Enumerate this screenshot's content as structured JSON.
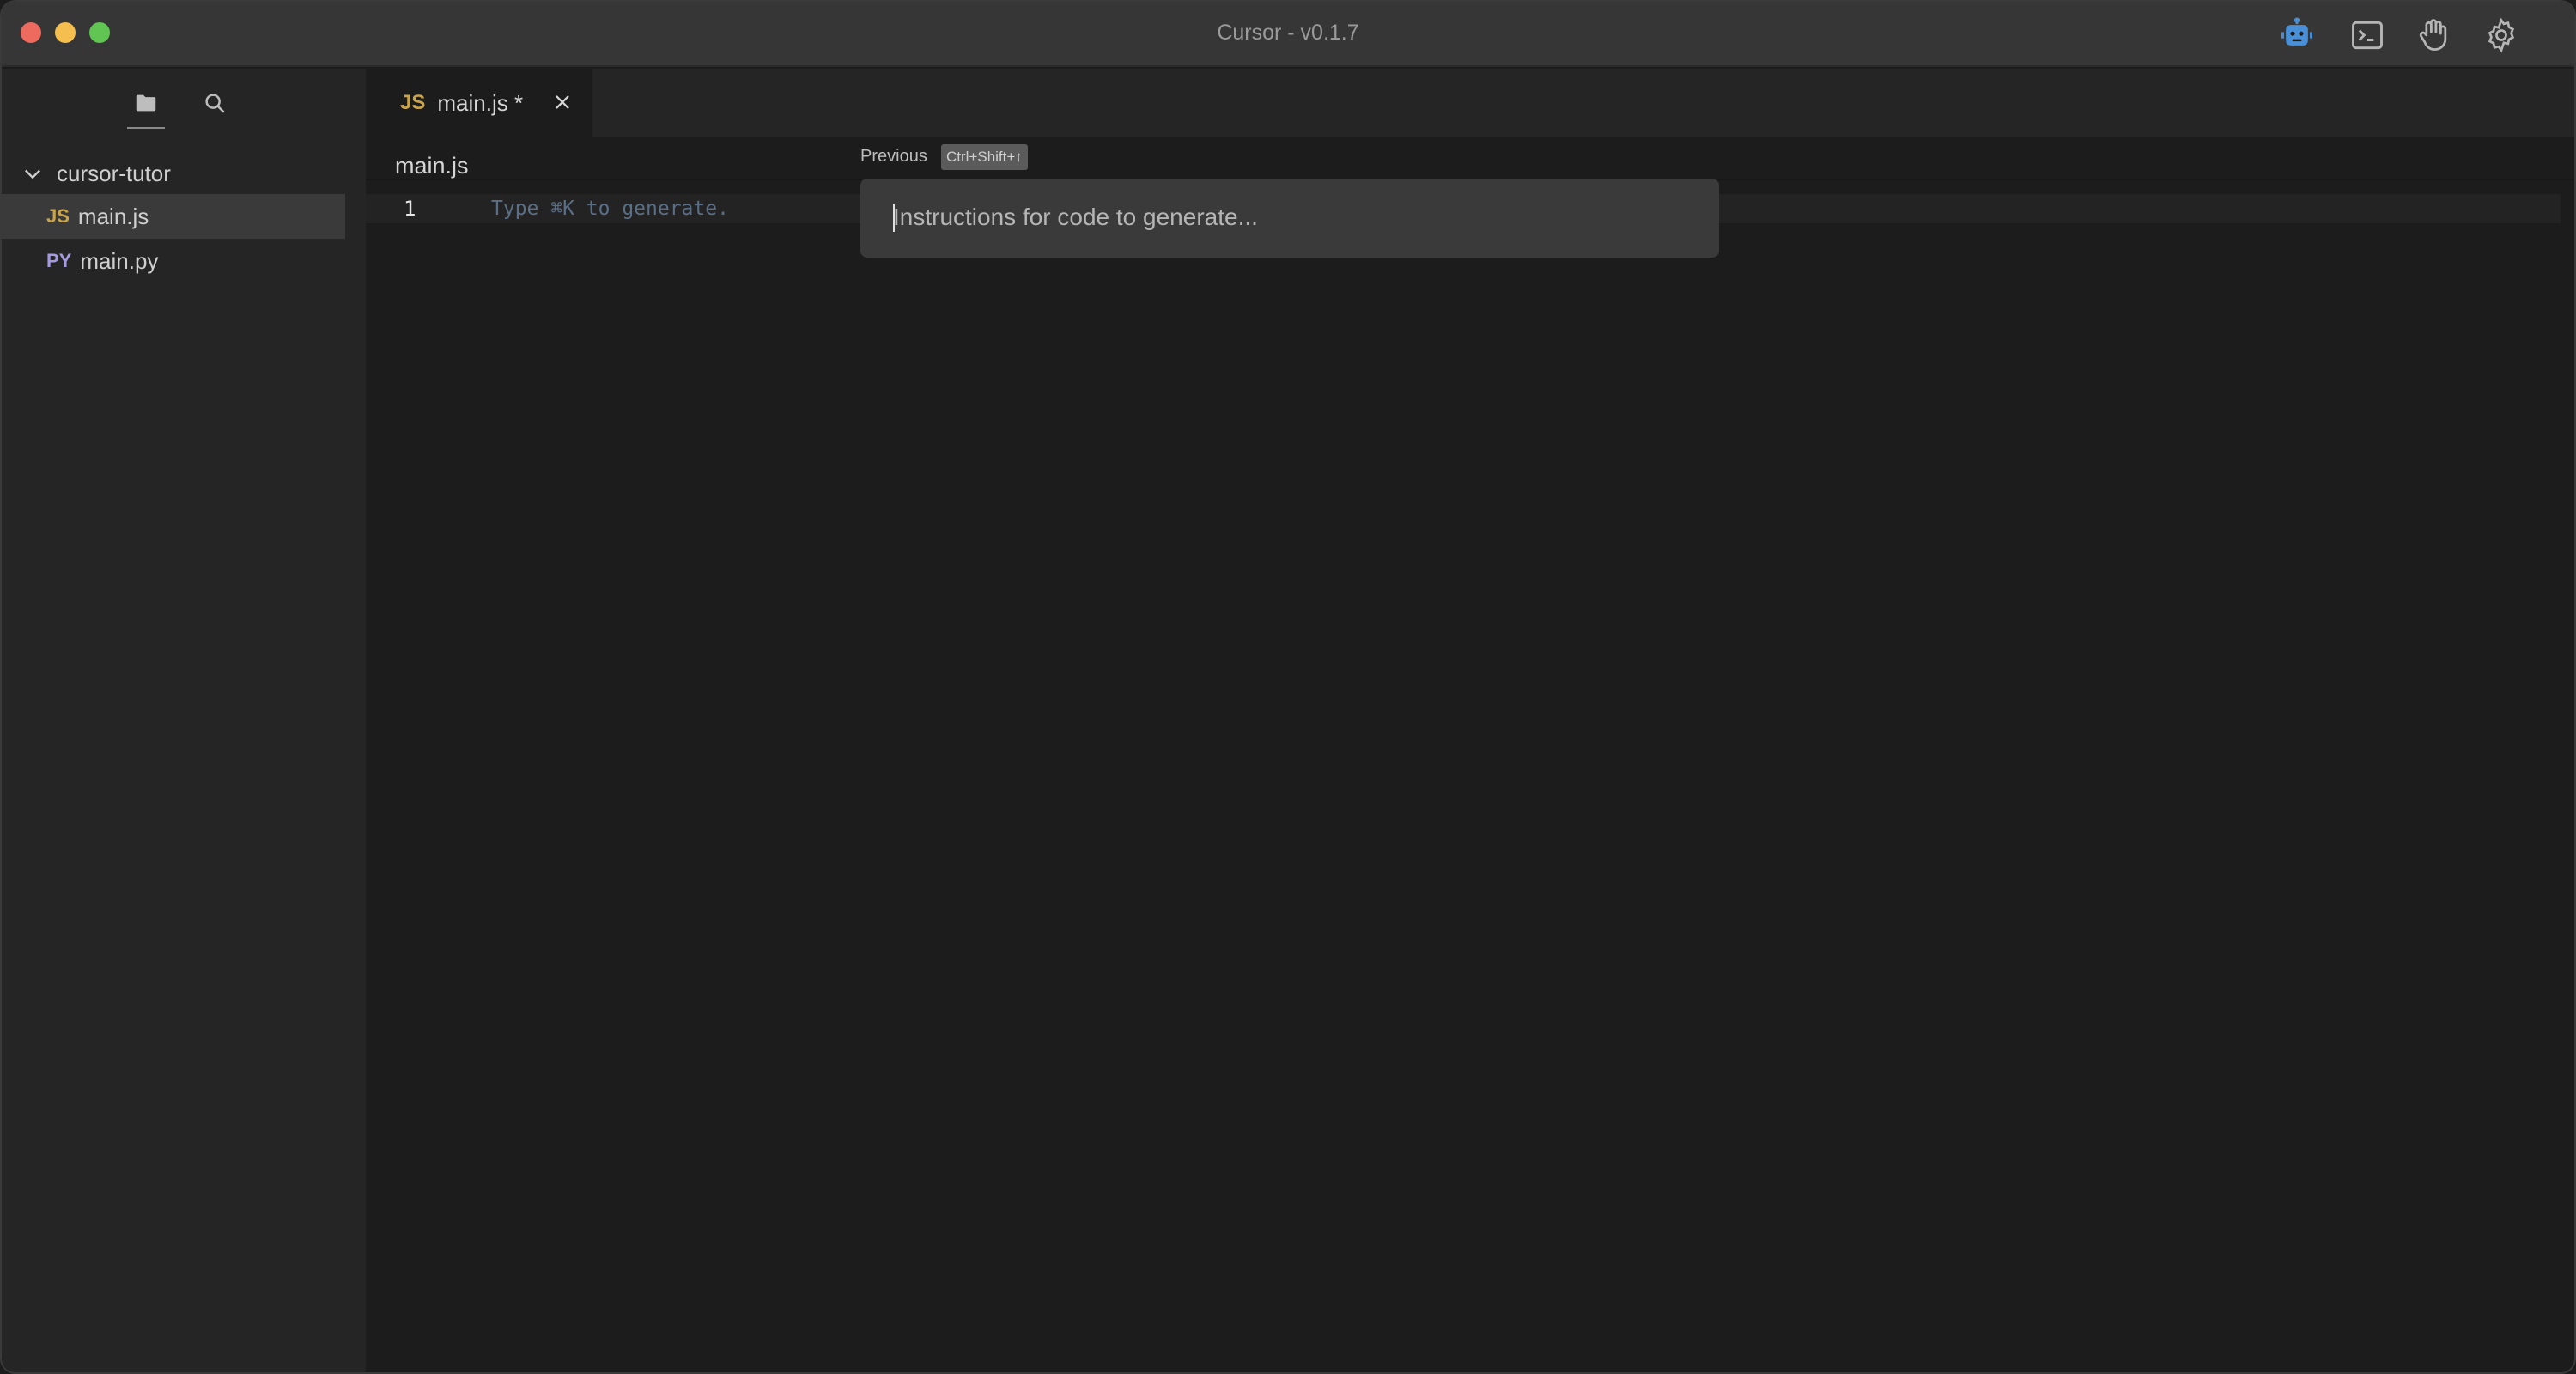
{
  "window": {
    "title": "Cursor - v0.1.7"
  },
  "toolbar": {
    "icons": [
      "robot-icon",
      "terminal-icon",
      "hand-icon",
      "gear-icon"
    ],
    "accent": "#4a90d9"
  },
  "sidebar": {
    "tabs": [
      "folder-icon",
      "search-icon"
    ],
    "root": {
      "label": "cursor-tutor"
    },
    "files": [
      {
        "type": "JS",
        "name": "main.js",
        "selected": true
      },
      {
        "type": "PY",
        "name": "main.py",
        "selected": false
      }
    ]
  },
  "editor": {
    "tab": {
      "type": "JS",
      "label": "main.js *"
    },
    "breadcrumb": "main.js",
    "line_number": "1",
    "placeholder": "Type ⌘K to generate."
  },
  "prompt": {
    "previous_label": "Previous",
    "shortcut": "Ctrl+Shift+↑",
    "placeholder": "Instructions for code to generate..."
  }
}
